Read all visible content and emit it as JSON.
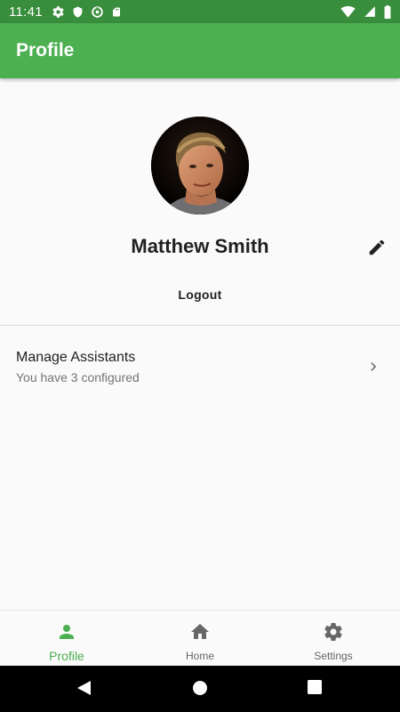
{
  "status_bar": {
    "time": "11:41",
    "left_icons": [
      "settings-icon",
      "shield-icon",
      "data-saver-icon",
      "sd-card-icon"
    ],
    "right_icons": [
      "wifi-icon",
      "signal-icon",
      "battery-icon"
    ]
  },
  "app_bar": {
    "title": "Profile"
  },
  "profile": {
    "name": "Matthew Smith",
    "logout_label": "Logout"
  },
  "list": {
    "items": [
      {
        "title": "Manage Assistants",
        "subtitle": "You have 3 configured"
      }
    ]
  },
  "bottom_nav": {
    "items": [
      {
        "label": "Profile",
        "icon": "person-icon",
        "active": true
      },
      {
        "label": "Home",
        "icon": "home-icon",
        "active": false
      },
      {
        "label": "Settings",
        "icon": "settings-icon",
        "active": false
      }
    ]
  },
  "colors": {
    "primary": "#4caf50",
    "primary_dark": "#388e3c",
    "text": "#212121",
    "secondary_text": "#757575"
  }
}
